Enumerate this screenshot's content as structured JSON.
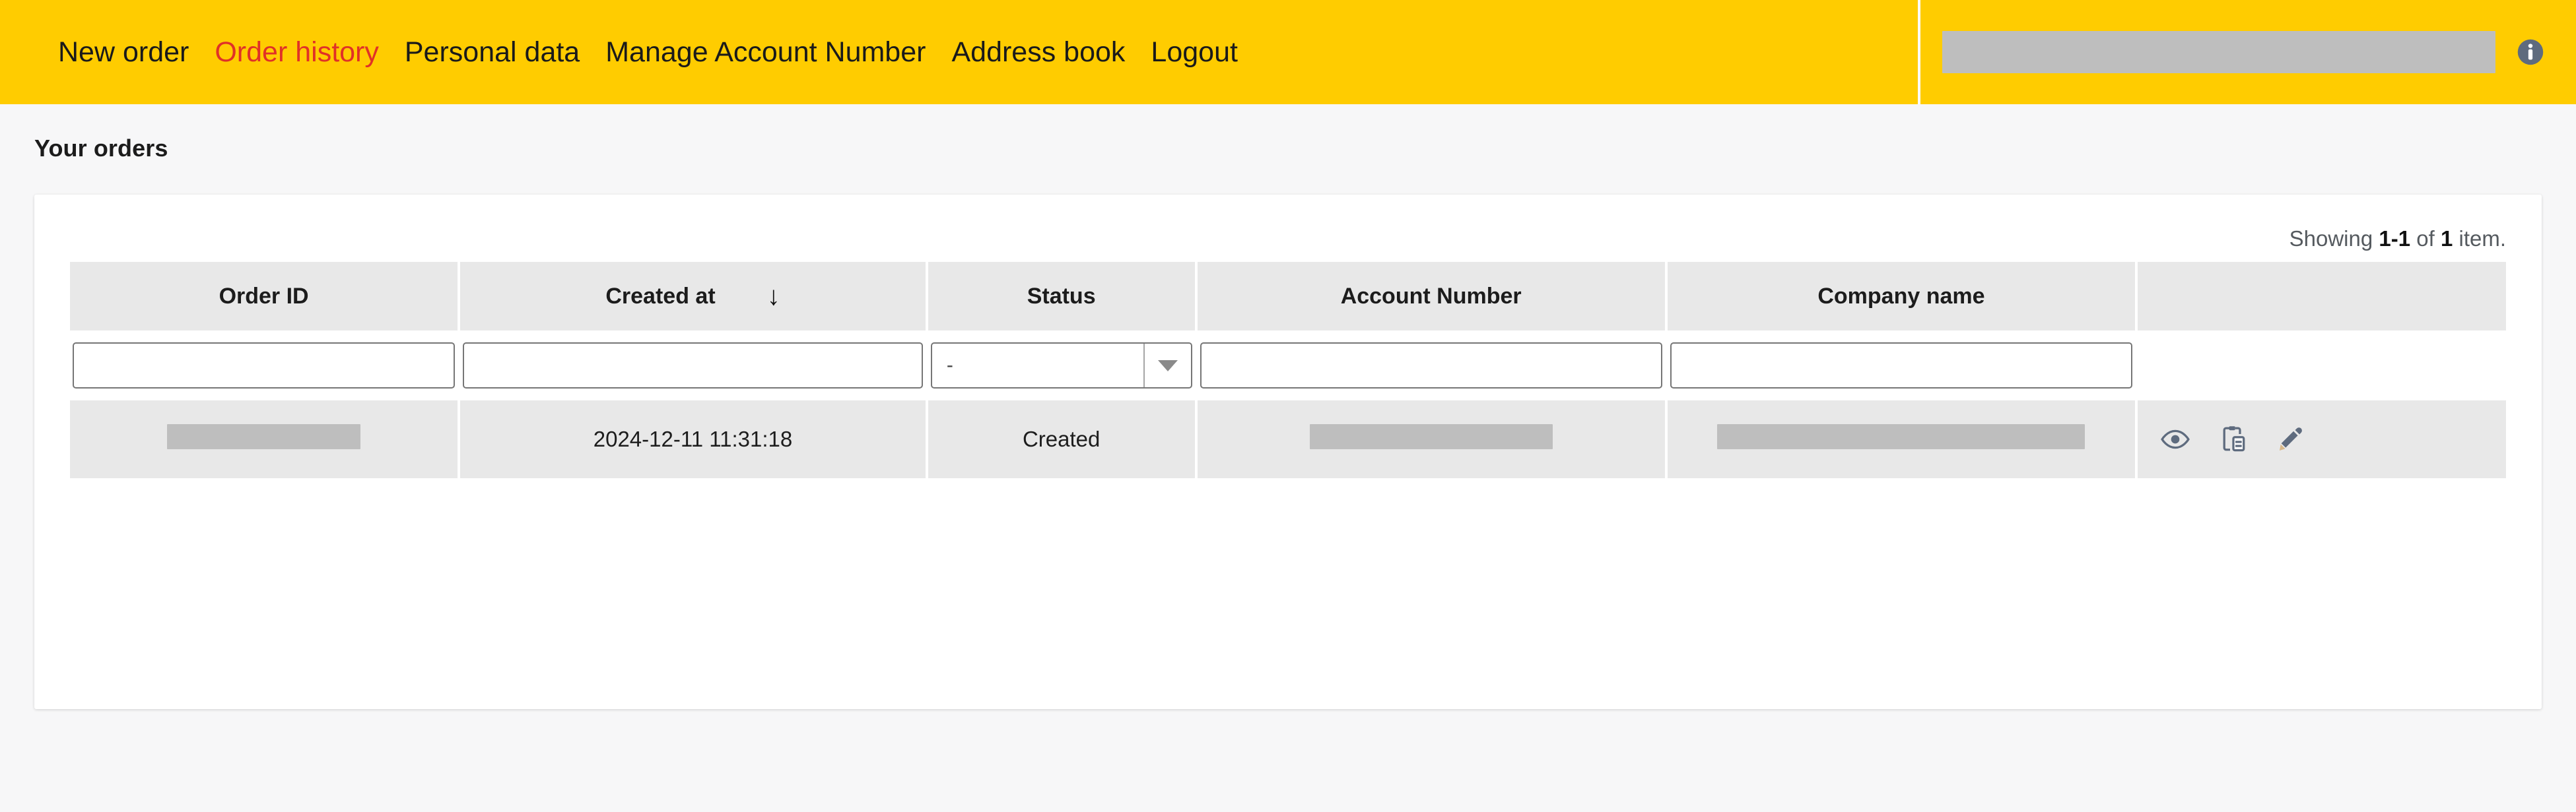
{
  "nav": {
    "items": [
      {
        "label": "New order",
        "active": false
      },
      {
        "label": "Order history",
        "active": true
      },
      {
        "label": "Personal data",
        "active": false
      },
      {
        "label": "Manage Account Number",
        "active": false
      },
      {
        "label": "Address book",
        "active": false
      },
      {
        "label": "Logout",
        "active": false
      }
    ],
    "search_value": "",
    "search_redacted": true,
    "info_icon": "info-icon",
    "background_color": "#ffcc00",
    "active_link_color": "#e03127"
  },
  "page": {
    "title": "Your orders"
  },
  "table": {
    "summary": {
      "prefix": "Showing ",
      "range": "1-1",
      "middle": " of ",
      "total": "1",
      "suffix": " item."
    },
    "columns": [
      {
        "label": "Order ID",
        "sort": ""
      },
      {
        "label": "Created at",
        "sort": "↓"
      },
      {
        "label": "Status",
        "sort": ""
      },
      {
        "label": "Account Number",
        "sort": ""
      },
      {
        "label": "Company name",
        "sort": ""
      },
      {
        "label": "",
        "sort": ""
      }
    ],
    "filters": {
      "order_id": {
        "value": "",
        "placeholder": ""
      },
      "created_at": {
        "value": "",
        "placeholder": ""
      },
      "status": {
        "value": "-",
        "options": [
          "-",
          "Created"
        ]
      },
      "account_number": {
        "value": "",
        "placeholder": ""
      },
      "company_name": {
        "value": "",
        "placeholder": ""
      }
    },
    "rows": [
      {
        "order_id": "",
        "order_id_redacted": true,
        "created_at": "2024-12-11 11:31:18",
        "status": "Created",
        "account_number": "",
        "account_number_redacted": true,
        "company_name": "",
        "company_name_redacted": true,
        "actions": [
          "eye-icon",
          "clipboard-paste-icon",
          "pencil-icon"
        ]
      }
    ]
  }
}
